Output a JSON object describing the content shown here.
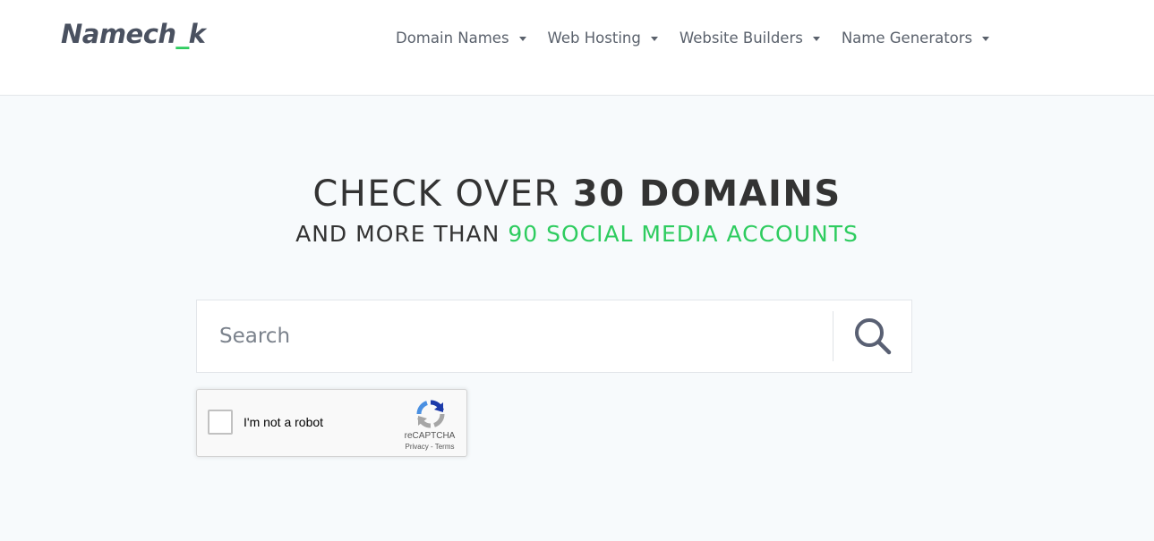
{
  "header": {
    "logo": {
      "part1": "Namech",
      "underscore": "_",
      "part2": "k"
    },
    "nav": [
      {
        "label": "Domain Names"
      },
      {
        "label": "Web Hosting"
      },
      {
        "label": "Website Builders"
      },
      {
        "label": "Name Generators"
      }
    ]
  },
  "hero": {
    "line1_regular": "CHECK OVER ",
    "line1_bold": "30 DOMAINS",
    "line2_regular": "AND MORE THAN ",
    "line2_highlight": "90 SOCIAL MEDIA ACCOUNTS"
  },
  "search": {
    "placeholder": "Search",
    "value": ""
  },
  "captcha": {
    "label": "I'm not a robot",
    "brand": "reCAPTCHA",
    "privacy": "Privacy",
    "separator": " - ",
    "terms": "Terms"
  },
  "colors": {
    "accent_green": "#2ecc5f",
    "logo_gray": "#4a5160",
    "nav_gray": "#5a616c",
    "page_background": "#f7fafc",
    "search_icon": "#596073"
  },
  "icons": {
    "nav_dropdown": "caret-down-icon",
    "search": "search-icon",
    "captcha": "recaptcha-logo-icon"
  }
}
